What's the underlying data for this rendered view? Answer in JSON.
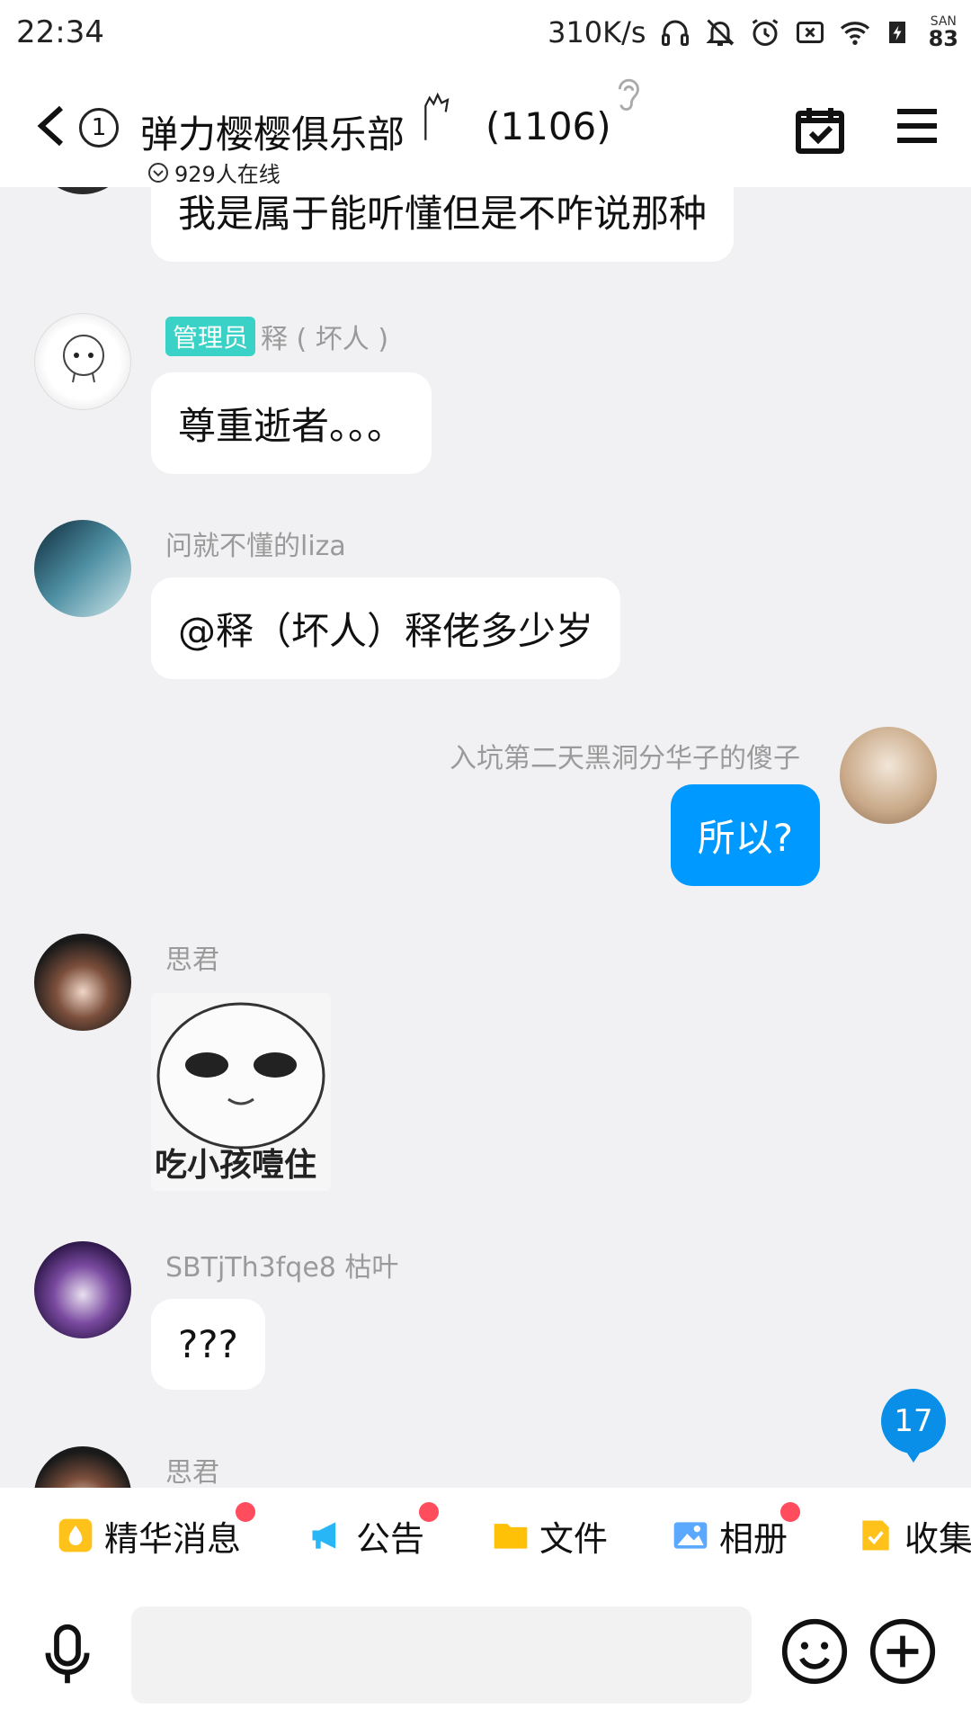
{
  "status_bar": {
    "time": "22:34",
    "net_speed": "310K/s",
    "battery_label": "SAN",
    "battery_value": "83"
  },
  "header": {
    "unread": "1",
    "title": "弹力樱樱俱乐部",
    "member_count": "(1106)",
    "online_text": "929人在线"
  },
  "messages": [
    {
      "id": 0,
      "sender": "",
      "text": "我是属于能听懂但是不咋说那种"
    },
    {
      "id": 1,
      "badge": "管理员",
      "sender": "释 ( 坏人 )",
      "text": "尊重逝者。。。"
    },
    {
      "id": 2,
      "sender": "问就不懂的liza",
      "text": "@释（坏人）释佬多少岁"
    },
    {
      "id": 3,
      "sender": "入坑第二天黑洞分华子的傻子",
      "text": "所以?"
    },
    {
      "id": 4,
      "sender": "思君",
      "sticker_caption": "吃小孩噎住"
    },
    {
      "id": 5,
      "sender": "SBTjTh3fqe8 枯叶",
      "text": "???"
    },
    {
      "id": 6,
      "sender": "思君"
    }
  ],
  "new_message_count": "17",
  "tools": [
    {
      "label": "精华消息",
      "icon": "essence-icon",
      "has_dot": true
    },
    {
      "label": "公告",
      "icon": "megaphone-icon",
      "has_dot": true
    },
    {
      "label": "文件",
      "icon": "folder-icon",
      "has_dot": false
    },
    {
      "label": "相册",
      "icon": "album-icon",
      "has_dot": true
    },
    {
      "label": "收集",
      "icon": "collect-icon",
      "has_dot": false
    }
  ],
  "input": {
    "placeholder": ""
  },
  "colors": {
    "accent": "#0099ff",
    "admin_badge": "#3ad1c6",
    "dot": "#ff4d5e"
  }
}
